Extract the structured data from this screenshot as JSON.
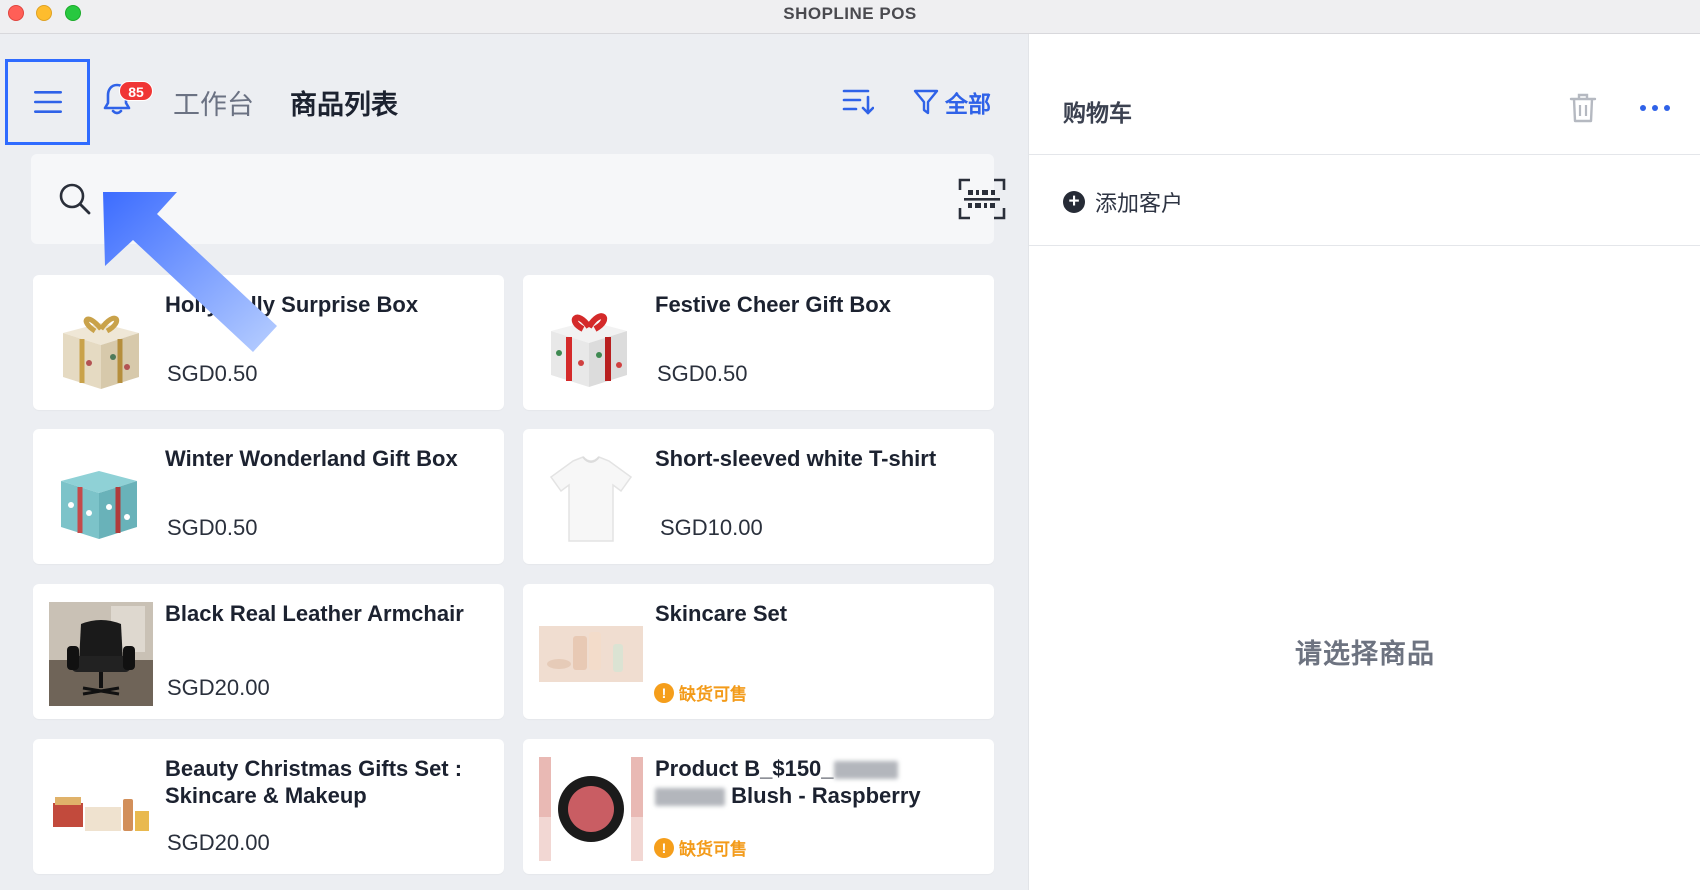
{
  "window": {
    "title": "SHOPLINE POS"
  },
  "header": {
    "notification_count": "85",
    "tab_workbench": "工作台",
    "tab_product_list": "商品列表",
    "filter_label": "全部"
  },
  "search": {
    "placeholder": ""
  },
  "products": [
    {
      "name": "Holly Jolly Surprise Box",
      "price": "SGD0.50",
      "stock_status": ""
    },
    {
      "name": "Festive Cheer Gift Box",
      "price": "SGD0.50",
      "stock_status": ""
    },
    {
      "name": "Winter Wonderland Gift Box",
      "price": "SGD0.50",
      "stock_status": ""
    },
    {
      "name": "Short-sleeved white T-shirt",
      "price": "SGD10.00",
      "stock_status": ""
    },
    {
      "name": "Black Real Leather Armchair",
      "price": "SGD20.00",
      "stock_status": ""
    },
    {
      "name": "Skincare Set",
      "price": "",
      "stock_status": "缺货可售"
    },
    {
      "name": "Beauty Christmas Gifts Set : Skincare & Makeup",
      "price": "SGD20.00",
      "stock_status": ""
    },
    {
      "name_part1": "Product B_$150_",
      "name_part2": "Blush - Raspberry",
      "price": "",
      "stock_status": "缺货可售"
    }
  ],
  "cart": {
    "title": "购物车",
    "add_customer": "添加客户",
    "empty_message": "请选择商品"
  },
  "colors": {
    "accent": "#2f62e8",
    "highlight_box": "#2f6bff",
    "badge": "#f03535",
    "warning": "#f39b1a"
  },
  "icons": {
    "menu": "hamburger-icon",
    "notifications": "bell-icon",
    "sort": "sort-icon",
    "filter": "filter-icon",
    "search": "search-icon",
    "scan": "barcode-scan-icon",
    "trash": "trash-icon",
    "more": "more-dots-icon",
    "add": "plus-circle-icon"
  }
}
